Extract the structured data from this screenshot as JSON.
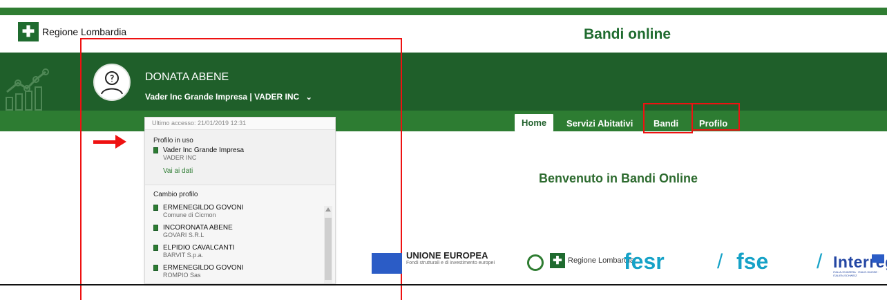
{
  "header": {
    "logo_text": "Regione\nLombardia",
    "site_title": "Bandi online"
  },
  "user": {
    "name": "DONATA ABENE",
    "company": "Vader Inc Grande Impresa | VADER INC"
  },
  "nav": {
    "items": [
      "Home",
      "Servizi Abitativi",
      "Bandi",
      "Profilo"
    ]
  },
  "main": {
    "welcome": "Benvenuto in Bandi Online"
  },
  "dropdown": {
    "last_access": "Ultimo accesso: 21/01/2019 12:31",
    "current_label": "Profilo in uso",
    "current_name": "Vader Inc Grande Impresa",
    "current_company": "VADER INC",
    "view_data": "Vai ai dati",
    "change_label": "Cambio profilo",
    "profiles": [
      {
        "name": "ERMENEGILDO GOVONI",
        "org": "Comune di Cicmon"
      },
      {
        "name": "INCORONATA ABENE",
        "org": "GOVARI S.R.L"
      },
      {
        "name": "ELPIDIO CAVALCANTI",
        "org": "BARVIT S.p.a."
      },
      {
        "name": "ERMENEGILDO GOVONI",
        "org": "ROMPIO Sas"
      }
    ]
  },
  "footer": {
    "eu_title": "UNIONE EUROPEA",
    "eu_subtitle": "Fondi strutturali e di investimento europei",
    "region": "Regione\nLombardia",
    "fesr": "fesr",
    "fse": "fse",
    "interreg": "Interreg",
    "interreg_small": "ITALIA-SVIZZERA · ITALIE-SUISSE · ITALIEN-SCHWEIZ"
  },
  "icons": [
    "building-icon",
    "user-avatar-icon",
    "chevron-down-icon",
    "arrow-right-icon"
  ],
  "colors": {
    "brand_green": "#2d7c32",
    "dark_green": "#1f5f2a",
    "highlight_red": "#e11"
  }
}
